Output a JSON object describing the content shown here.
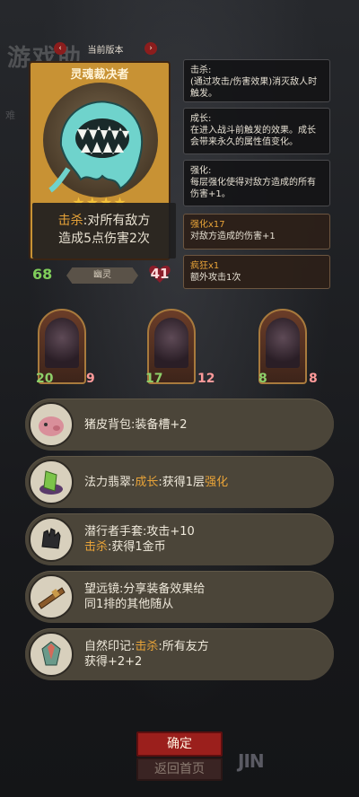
{
  "background": {
    "title": "游戏助",
    "side_text": "难"
  },
  "version_bar": {
    "label": "当前版本",
    "prev_glyph": "‹",
    "next_glyph": "›"
  },
  "unit": {
    "name": "灵魂裁决者",
    "stars": "★★★★",
    "desc_keyword": "击杀",
    "desc_rest_1": ":对所有敌方",
    "desc_line_2": "造成5点伤害2次",
    "attack": "68",
    "health": "41",
    "tribe": "幽灵"
  },
  "tooltips": [
    {
      "title": "击杀:",
      "body": "(通过攻击/伤害效果)消灭敌人时触发。",
      "type": "keyword"
    },
    {
      "title": "成长:",
      "body": "在进入战斗前触发的效果。成长会带来永久的属性值变化。",
      "type": "keyword"
    },
    {
      "title": "强化:",
      "body": "每层强化使得对敌方造成的所有伤害+1。",
      "type": "keyword"
    },
    {
      "title": "强化x17",
      "body": "对敌方造成的伤害+1",
      "type": "status"
    },
    {
      "title": "疯狂x1",
      "body": "额外攻击1次",
      "type": "status"
    }
  ],
  "board_units": [
    {
      "attack": "20",
      "health": "9"
    },
    {
      "attack": "17",
      "health": "12"
    },
    {
      "attack": "8",
      "health": "8"
    }
  ],
  "items": [
    {
      "icon": "pig-bag-icon",
      "line1": "猪皮背包:装备槽+2",
      "line2": ""
    },
    {
      "icon": "emerald-icon",
      "prefix": "法力翡翠:",
      "kw1": "成长",
      "mid": ":获得1层",
      "kw2": "强化"
    },
    {
      "icon": "glove-icon",
      "line1": "潜行者手套:攻击+10",
      "kw": "击杀",
      "line2": ":获得1金币"
    },
    {
      "icon": "telescope-icon",
      "line1": "望远镜:分享装备效果给",
      "line2": "同1排的其他随从"
    },
    {
      "icon": "seal-icon",
      "prefix": "自然印记:",
      "kw": "击杀",
      "rest": ":所有友方",
      "line2": "获得+2+2"
    }
  ],
  "buttons": {
    "confirm": "确定",
    "home": "返回首页"
  },
  "watermark": "JIN",
  "colors": {
    "keyword": "#e8a338",
    "growth": "#79c64a",
    "confirm": "#9b1f1c"
  }
}
